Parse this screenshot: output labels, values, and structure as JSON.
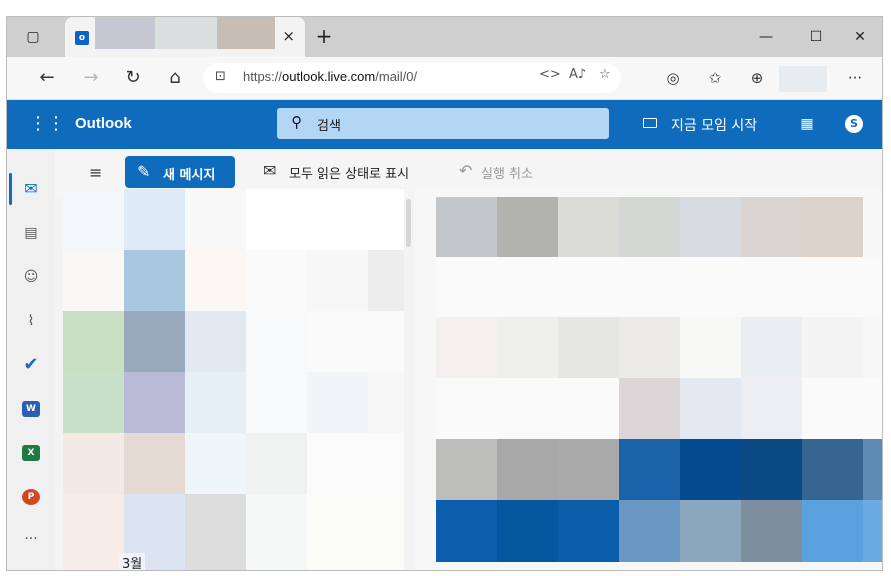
{
  "browser": {
    "tab": {
      "favicon": "outlook-icon",
      "close_label": "×"
    },
    "new_tab_label": "+",
    "window_controls": {
      "minimize": "—",
      "maximize": "☐",
      "close": "✕"
    },
    "toolbar": {
      "back": "←",
      "forward": "→",
      "refresh": "↻",
      "home": "⌂",
      "lock": "🔒",
      "url_prefix": "https://",
      "url_host": "outlook.live.com",
      "url_path": "/mail/0/",
      "more": "···"
    }
  },
  "outlook": {
    "header": {
      "brand": "Outlook",
      "search_placeholder": "검색",
      "meet_now": "지금 모임 시작",
      "skype": "S"
    },
    "rail": {
      "items": [
        "mail-icon",
        "calendar-icon",
        "people-icon",
        "attachment-icon",
        "todo-icon",
        "word-icon",
        "excel-icon",
        "powerpoint-icon",
        "more-apps-icon"
      ],
      "word": "W",
      "excel": "X",
      "powerpoint": "P",
      "more": "···"
    },
    "commands": {
      "new_message": "새 메시지",
      "mark_all_read": "모두 읽은 상태로 표시",
      "undo": "실행 취소"
    },
    "message_list": {
      "group_label": "3월"
    }
  },
  "colors": {
    "outlook_blue": "#0f6cbd",
    "search_box": "#b4d6f5"
  }
}
